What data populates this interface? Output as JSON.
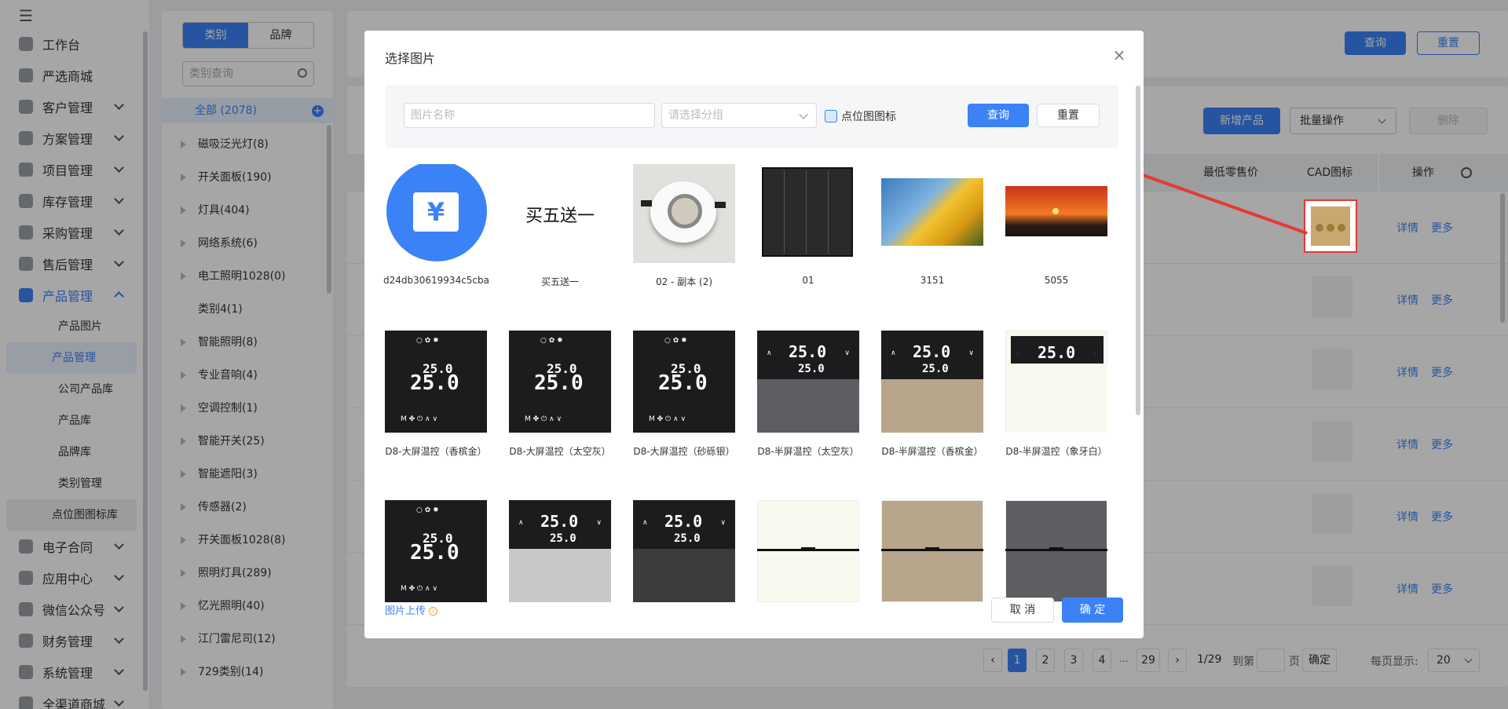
{
  "sidebar": {
    "menu_icon": "☰",
    "items": [
      {
        "label": "工作台",
        "icon": "workbench-icon",
        "expand": ""
      },
      {
        "label": "严选商城",
        "icon": "mall-icon",
        "expand": ""
      },
      {
        "label": "客户管理",
        "icon": "customer-icon",
        "expand": "down"
      },
      {
        "label": "方案管理",
        "icon": "plan-icon",
        "expand": "down"
      },
      {
        "label": "项目管理",
        "icon": "project-icon",
        "expand": "down"
      },
      {
        "label": "库存管理",
        "icon": "inventory-icon",
        "expand": "down"
      },
      {
        "label": "采购管理",
        "icon": "purchase-icon",
        "expand": "down"
      },
      {
        "label": "售后管理",
        "icon": "headset-icon",
        "expand": "down"
      },
      {
        "label": "产品管理",
        "icon": "product-icon",
        "expand": "up",
        "active": true
      }
    ],
    "sub_items": [
      {
        "label": "产品图片"
      },
      {
        "label": "产品管理",
        "active": true
      },
      {
        "label": "公司产品库"
      },
      {
        "label": "产品库"
      },
      {
        "label": "品牌库"
      },
      {
        "label": "类别管理"
      },
      {
        "label": "点位图图标库",
        "highlight": true
      }
    ],
    "items_after": [
      {
        "label": "电子合同",
        "icon": "contract-icon"
      },
      {
        "label": "应用中心",
        "icon": "apps-icon"
      },
      {
        "label": "微信公众号",
        "icon": "wechat-icon"
      },
      {
        "label": "财务管理",
        "icon": "finance-icon"
      },
      {
        "label": "系统管理",
        "icon": "settings-icon"
      },
      {
        "label": "全渠道商城",
        "icon": "omnichannel-icon"
      }
    ]
  },
  "category_panel": {
    "tabs": [
      "类别",
      "品牌"
    ],
    "search_placeholder": "类别查询",
    "all_label": "全部 (2078)",
    "items": [
      {
        "label": "磁吸泛光灯(8)",
        "expandable": true
      },
      {
        "label": "开关面板(190)",
        "expandable": true
      },
      {
        "label": "灯具(404)",
        "expandable": true
      },
      {
        "label": "网络系统(6)",
        "expandable": true
      },
      {
        "label": "电工照明1028(0)",
        "expandable": true
      },
      {
        "label": "类别4(1)",
        "expandable": false
      },
      {
        "label": "智能照明(8)",
        "expandable": true
      },
      {
        "label": "专业音响(4)",
        "expandable": true
      },
      {
        "label": "空调控制(1)",
        "expandable": true
      },
      {
        "label": "智能开关(25)",
        "expandable": true
      },
      {
        "label": "智能遮阳(3)",
        "expandable": true
      },
      {
        "label": "传感器(2)",
        "expandable": true
      },
      {
        "label": "开关面板1028(8)",
        "expandable": true
      },
      {
        "label": "照明灯具(289)",
        "expandable": true
      },
      {
        "label": "忆光照明(40)",
        "expandable": true
      },
      {
        "label": "江门雷尼司(12)",
        "expandable": true
      },
      {
        "label": "729类别(14)",
        "expandable": true
      }
    ]
  },
  "top_bar": {
    "query": "查询",
    "reset": "重置"
  },
  "main": {
    "add_product": "新增产品",
    "batch_ops": "批量操作",
    "delete": "删除",
    "columns": {
      "min_price": "最低零售价",
      "cad_icon": "CAD图标",
      "ops": "操作"
    },
    "row_actions": {
      "detail": "详情",
      "more": "更多"
    },
    "rows": 6
  },
  "pagination": {
    "pages": [
      "1",
      "2",
      "3",
      "4",
      "...",
      "29"
    ],
    "current": "1",
    "total": "1/29",
    "goto_label": "到第",
    "page_unit": "页",
    "confirm": "确定",
    "per_page_label": "每页显示:",
    "per_page": "20"
  },
  "modal": {
    "title": "选择图片",
    "name_placeholder": "图片名称",
    "group_placeholder": "请选择分组",
    "checkbox_label": "点位图图标",
    "query": "查询",
    "reset": "重置",
    "upload": "图片上传",
    "cancel": "取 消",
    "confirm": "确 定",
    "images": [
      {
        "caption": "d24db30619934c5cba30...",
        "kind": "yuan"
      },
      {
        "caption": "买五送一",
        "kind": "text",
        "text": "买五送一"
      },
      {
        "caption": "02 - 副本 (2)",
        "kind": "downlight"
      },
      {
        "caption": "01",
        "kind": "panel"
      },
      {
        "caption": "3151",
        "kind": "leaves"
      },
      {
        "caption": "5055",
        "kind": "sunset"
      },
      {
        "caption": "D8-大屏温控（香槟金）",
        "kind": "thermo-full"
      },
      {
        "caption": "D8-大屏温控（太空灰）",
        "kind": "thermo-full"
      },
      {
        "caption": "D8-大屏温控（砂砾银）",
        "kind": "thermo-full"
      },
      {
        "caption": "D8-半屏温控（太空灰）",
        "kind": "thermo-half",
        "color": "#5e5e62"
      },
      {
        "caption": "D8-半屏温控（香槟金）",
        "kind": "thermo-half",
        "color": "#b7a68c"
      },
      {
        "caption": "D8-半屏温控（象牙白）",
        "kind": "thermo-half-ivory",
        "color": "#faf9ef"
      },
      {
        "caption": "",
        "kind": "thermo-full"
      },
      {
        "caption": "",
        "kind": "thermo-half",
        "color": "#c8c8c8"
      },
      {
        "caption": "",
        "kind": "thermo-half",
        "color": "#3c3c3e"
      },
      {
        "caption": "",
        "kind": "switch",
        "color": "#faf9ef"
      },
      {
        "caption": "",
        "kind": "switch",
        "color": "#b7a68c"
      },
      {
        "caption": "",
        "kind": "switch",
        "color": "#5e5e62"
      }
    ],
    "thermo_value": "25.0"
  }
}
